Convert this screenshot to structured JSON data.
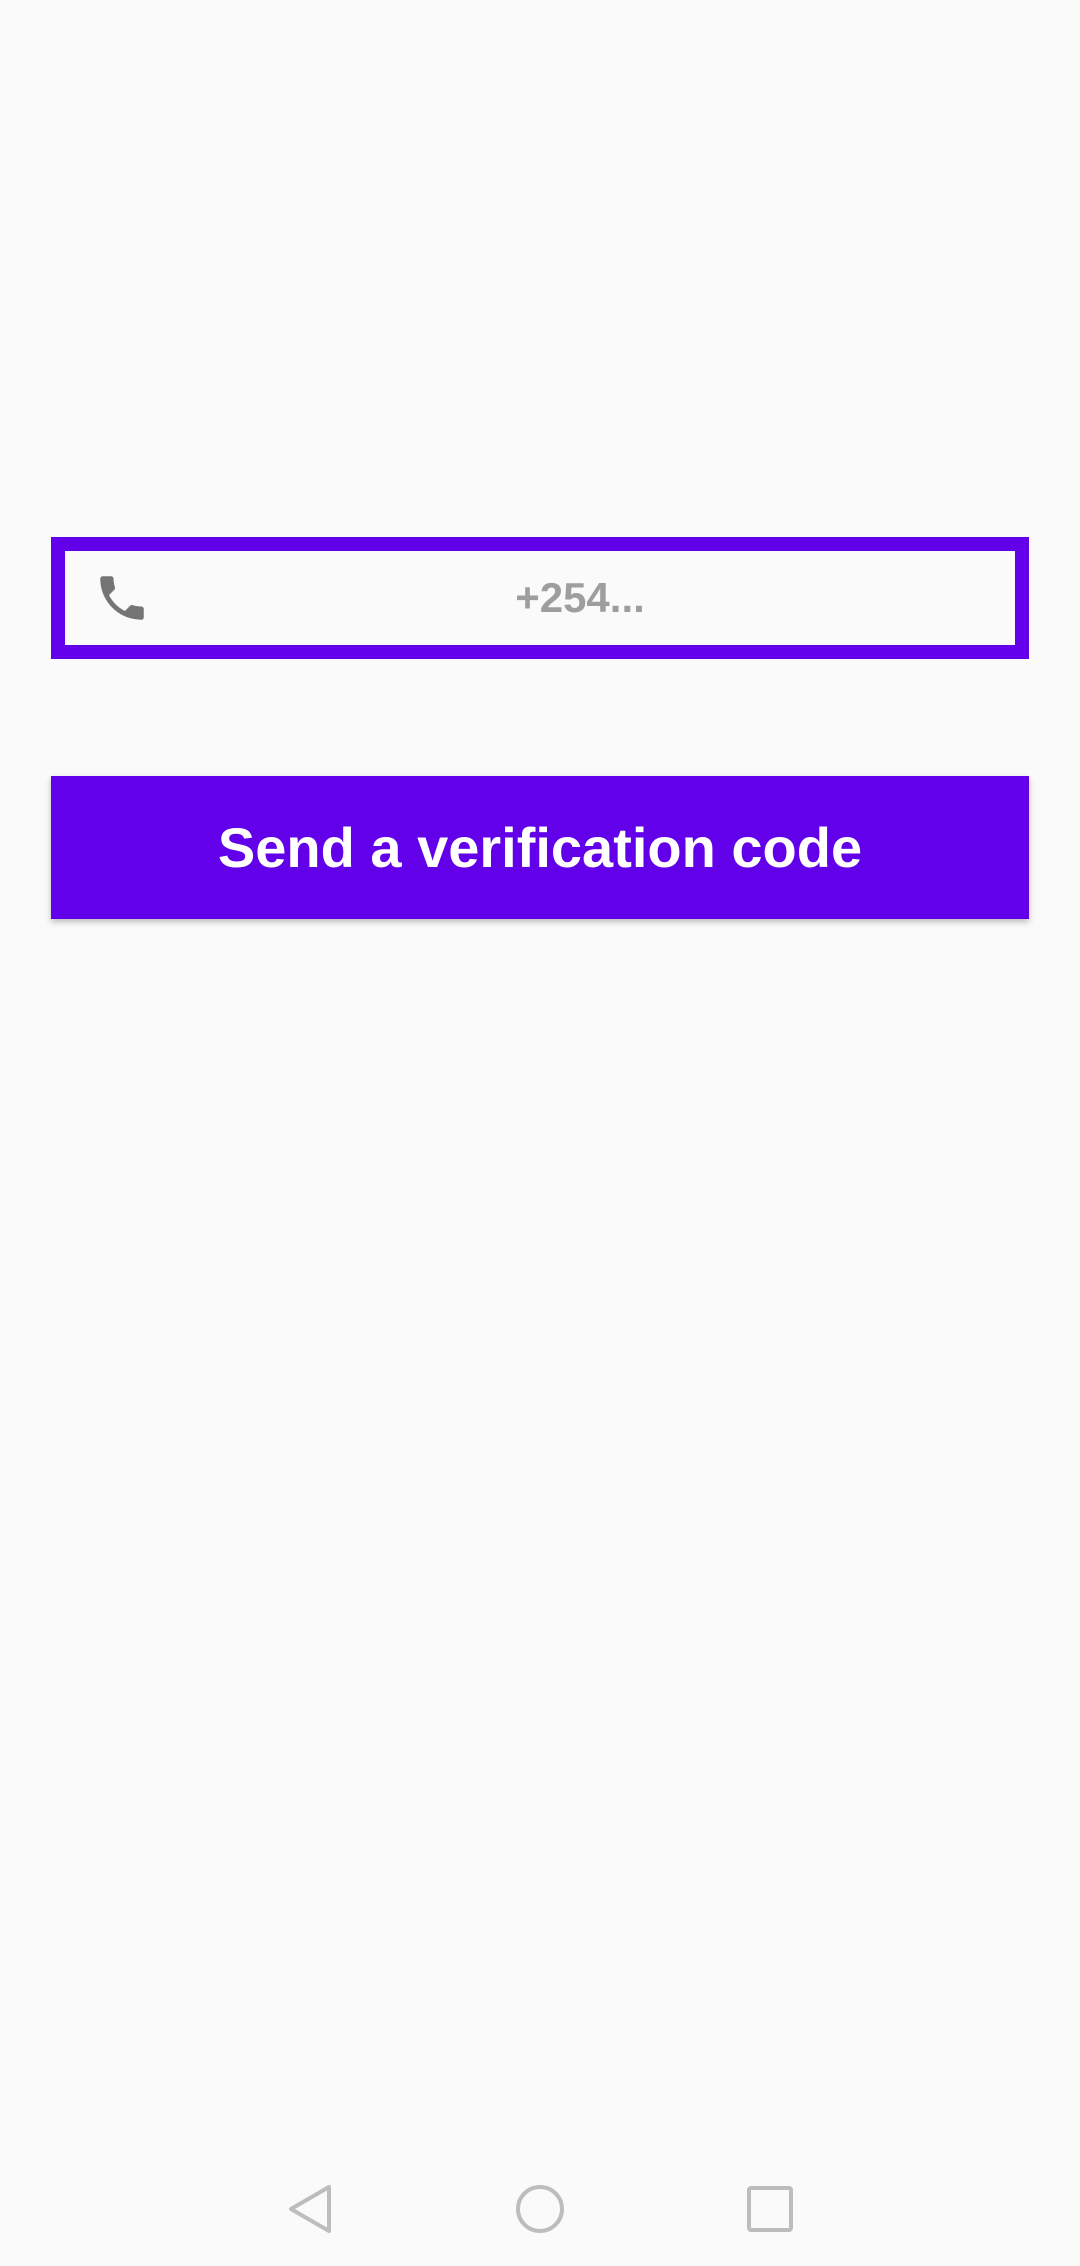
{
  "phone_input": {
    "placeholder": "+254...",
    "value": ""
  },
  "send_button": {
    "label": "Send a verification code"
  },
  "icons": {
    "phone": "phone-icon",
    "back": "back-triangle-icon",
    "home": "home-circle-icon",
    "recents": "recents-square-icon"
  },
  "colors": {
    "accent": "#6200ea",
    "background": "#fafafa",
    "placeholder": "#9e9e9e",
    "icon": "#757575",
    "nav_icon": "#bdbdbd"
  }
}
